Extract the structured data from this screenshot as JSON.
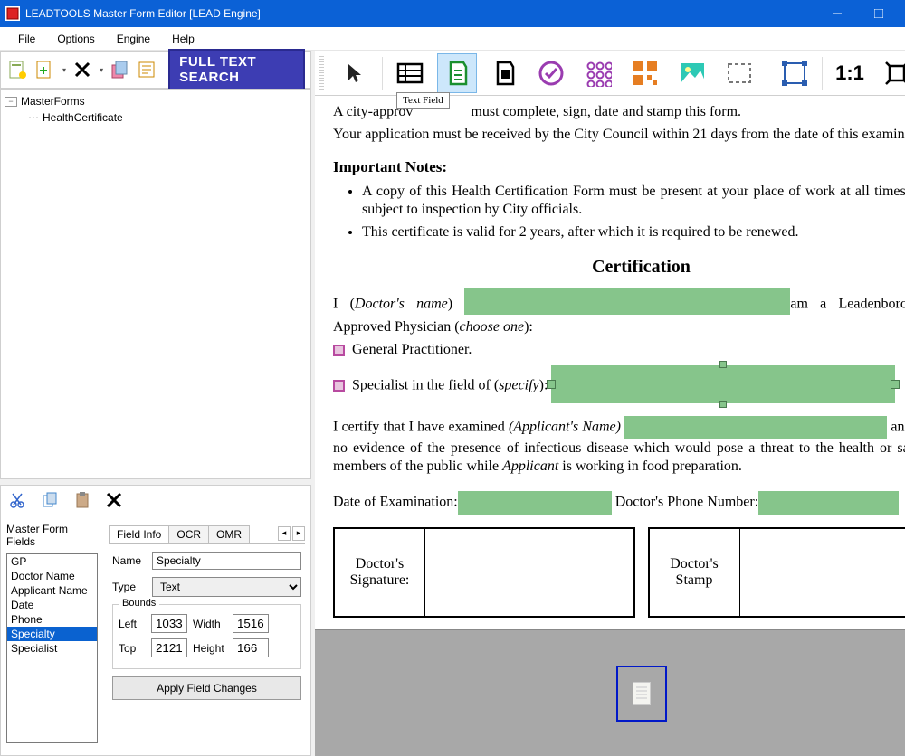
{
  "window": {
    "title": "LEADTOOLS Master Form Editor [LEAD Engine]"
  },
  "menu": {
    "file": "File",
    "options": "Options",
    "engine": "Engine",
    "help": "Help"
  },
  "leftToolbar": {
    "fulltext": "FULL TEXT SEARCH"
  },
  "tree": {
    "root": "MasterForms",
    "child1": "HealthCertificate"
  },
  "fieldListLabel": "Master Form Fields",
  "fieldList": [
    "GP",
    "Doctor Name",
    "Applicant Name",
    "Date",
    "Phone",
    "Specialty",
    "Specialist"
  ],
  "fieldListSelected": "Specialty",
  "tabs": {
    "a": "Field Info",
    "b": "OCR",
    "c": "OMR"
  },
  "form": {
    "nameLabel": "Name",
    "name": "Specialty",
    "typeLabel": "Type",
    "type": "Text",
    "boundsLabel": "Bounds",
    "leftLabel": "Left",
    "left": "1033",
    "widthLabel": "Width",
    "width": "1516",
    "topLabel": "Top",
    "top": "2121",
    "heightLabel": "Height",
    "height": "166",
    "applyBtn": "Apply Field Changes"
  },
  "tooltip": "Text Field",
  "doc": {
    "line1a": "A city-approv",
    "line1b": " must complete, sign, date and stamp this form.",
    "line2": "Your application must be received by the City Council within 21 days from the date of this examination.",
    "notesHeading": "Important Notes:",
    "note1": "A copy of this Health Certification Form must be present at your place of work at all times, and is subject to inspection by City officials.",
    "note2": "This certificate is valid for 2 years, after which it is required to be renewed.",
    "certTitle": "Certification",
    "cert1a": "I (",
    "cert1b": "Doctor's name",
    "cert1c": ") ",
    "cert1d": "am a Leadenboro City-Approved Physician (",
    "cert1e": "choose one",
    "cert1f": "):",
    "gp": " General Practitioner.",
    "spec1": " Specialist in the field of (",
    "spec2": "specify",
    "spec3": "): ",
    "body1a": "I certify that I have examined ",
    "body1b": "(Applicant's Name)",
    "body2a": "and found no evidence of the presence of infectious disease which would pose a threat to the health or safety of members of the public while ",
    "body2b": "Applicant",
    "body2c": " is working in food preparation.",
    "dateLabel": "Date of Examination:",
    "phoneLabel": " Doctor's Phone Number:",
    "sigLabel": "Doctor's Signature:",
    "stampLabel": "Doctor's Stamp"
  }
}
